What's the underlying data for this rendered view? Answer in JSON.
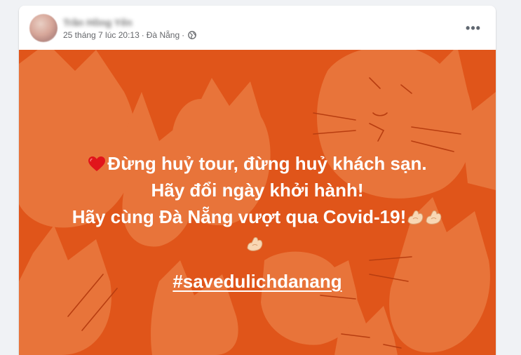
{
  "post": {
    "author_name": "Trần Hồng Yến",
    "date": "25 tháng 7 lúc 20:13",
    "separator": "·",
    "location": "Đà Nẵng",
    "privacy_icon": "globe-icon",
    "more_icon": "more-options-icon",
    "more_label": "•••"
  },
  "content": {
    "line1": "Đừng huỷ tour, đừng huỷ khách sạn.",
    "line2": "Hãy đổi ngày khởi hành!",
    "line3": "Hãy cùng Đà Nẵng vượt qua Covid-19!",
    "hashtag": "#savedulichdanang",
    "line1_icon": "red-heart-icon",
    "line3_icons": [
      "flexed-biceps-icon",
      "flexed-biceps-icon",
      "flexed-biceps-icon"
    ]
  },
  "colors": {
    "background": "#e0551a",
    "pattern": "#e8743a",
    "text": "#ffffff"
  }
}
